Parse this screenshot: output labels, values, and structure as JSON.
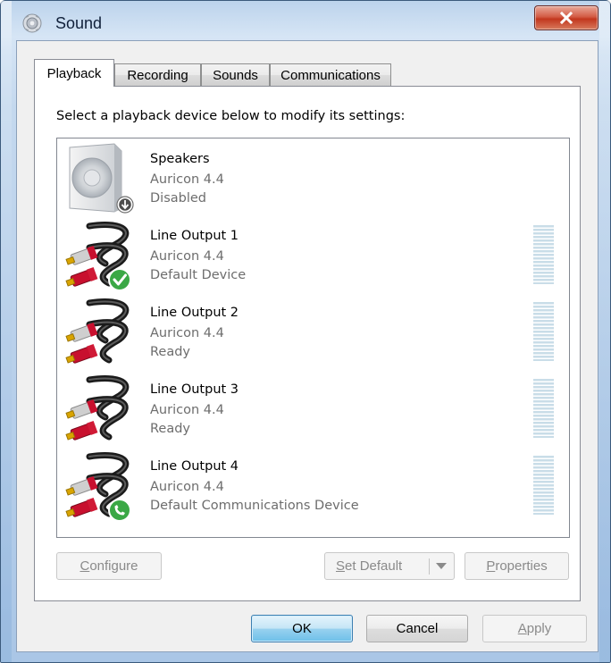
{
  "window": {
    "title": "Sound",
    "close_symbol": "X"
  },
  "tabs": [
    {
      "label": "Playback",
      "active": true
    },
    {
      "label": "Recording",
      "active": false
    },
    {
      "label": "Sounds",
      "active": false
    },
    {
      "label": "Communications",
      "active": false
    }
  ],
  "playback": {
    "instruction": "Select a playback device below to modify its settings:",
    "devices": [
      {
        "name": "Speakers",
        "driver": "Auricon 4.4",
        "status": "Disabled",
        "icon": "speaker-icon",
        "badge": "disabled-down-arrow-badge",
        "meter": false
      },
      {
        "name": "Line Output 1",
        "driver": "Auricon 4.4",
        "status": "Default Device",
        "icon": "rca-cable-icon",
        "badge": "default-checkmark-badge",
        "meter": true
      },
      {
        "name": "Line Output 2",
        "driver": "Auricon 4.4",
        "status": "Ready",
        "icon": "rca-cable-icon",
        "badge": null,
        "meter": true
      },
      {
        "name": "Line Output 3",
        "driver": "Auricon 4.4",
        "status": "Ready",
        "icon": "rca-cable-icon",
        "badge": null,
        "meter": true
      },
      {
        "name": "Line Output 4",
        "driver": "Auricon 4.4",
        "status": "Default Communications Device",
        "icon": "rca-cable-icon",
        "badge": "communications-phone-badge",
        "meter": true
      }
    ],
    "configure_label_prefix": "C",
    "configure_label_rest": "onfigure",
    "set_default_prefix": "S",
    "set_default_rest": "et Default",
    "properties_prefix": "P",
    "properties_rest": "roperties"
  },
  "footer": {
    "ok_label": "OK",
    "cancel_label": "Cancel",
    "apply_prefix": "A",
    "apply_rest": "pply"
  },
  "colors": {
    "accent": "#3c7fb1",
    "close_red": "#c2371e",
    "meter": "#c9dde8",
    "check_green": "#3aa845"
  }
}
